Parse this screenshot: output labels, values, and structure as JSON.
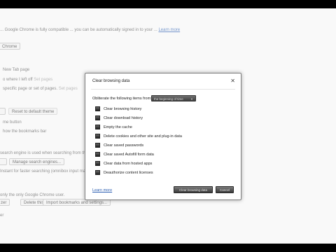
{
  "background": {
    "lines": [
      {
        "text": "... Google Chrome is fully compatible ... you can be automatically signed in to your ...",
        "link": "Learn more"
      },
      {
        "text": "New Tab page"
      },
      {
        "text": "o where I left off",
        "link": "Set pages"
      },
      {
        "text": "specific page or set of pages.",
        "link": "Set pages"
      },
      {
        "text": "me button"
      },
      {
        "text": "how the bookmarks bar"
      },
      {
        "text": "search engine is used when searching from the",
        "link": "omnibox"
      },
      {
        "text": "Instant for faster searching (omnibox input may be",
        "link": "logged"
      },
      {
        "text": "only the only Google Chrome user."
      },
      {
        "text": "er"
      }
    ],
    "buttons": {
      "chrome": "Chrome",
      "theme": "Reset to default theme",
      "manage_search": "Manage search engines...",
      "user_left": "zer",
      "delete_user": "Delete this user",
      "import_bookmarks": "Import bookmarks and settings..."
    }
  },
  "dialog": {
    "title": "Clear browsing data",
    "close_glyph": "✕",
    "obliterate_label": "Obliterate the following items from:",
    "time_range_selected": "the beginning of time",
    "options": [
      {
        "label": "Clear browsing history",
        "checked": true
      },
      {
        "label": "Clear download history",
        "checked": true
      },
      {
        "label": "Empty the cache",
        "checked": true
      },
      {
        "label": "Delete cookies and other site and plug-in data",
        "checked": true
      },
      {
        "label": "Clear saved passwords",
        "checked": true
      },
      {
        "label": "Clear saved Autofill form data",
        "checked": true
      },
      {
        "label": "Clear data from hosted apps",
        "checked": true
      },
      {
        "label": "Deauthorize content licenses",
        "checked": true
      }
    ],
    "learn_more": "Learn more",
    "clear_button": "Clear browsing data",
    "cancel_button": "Cancel"
  }
}
